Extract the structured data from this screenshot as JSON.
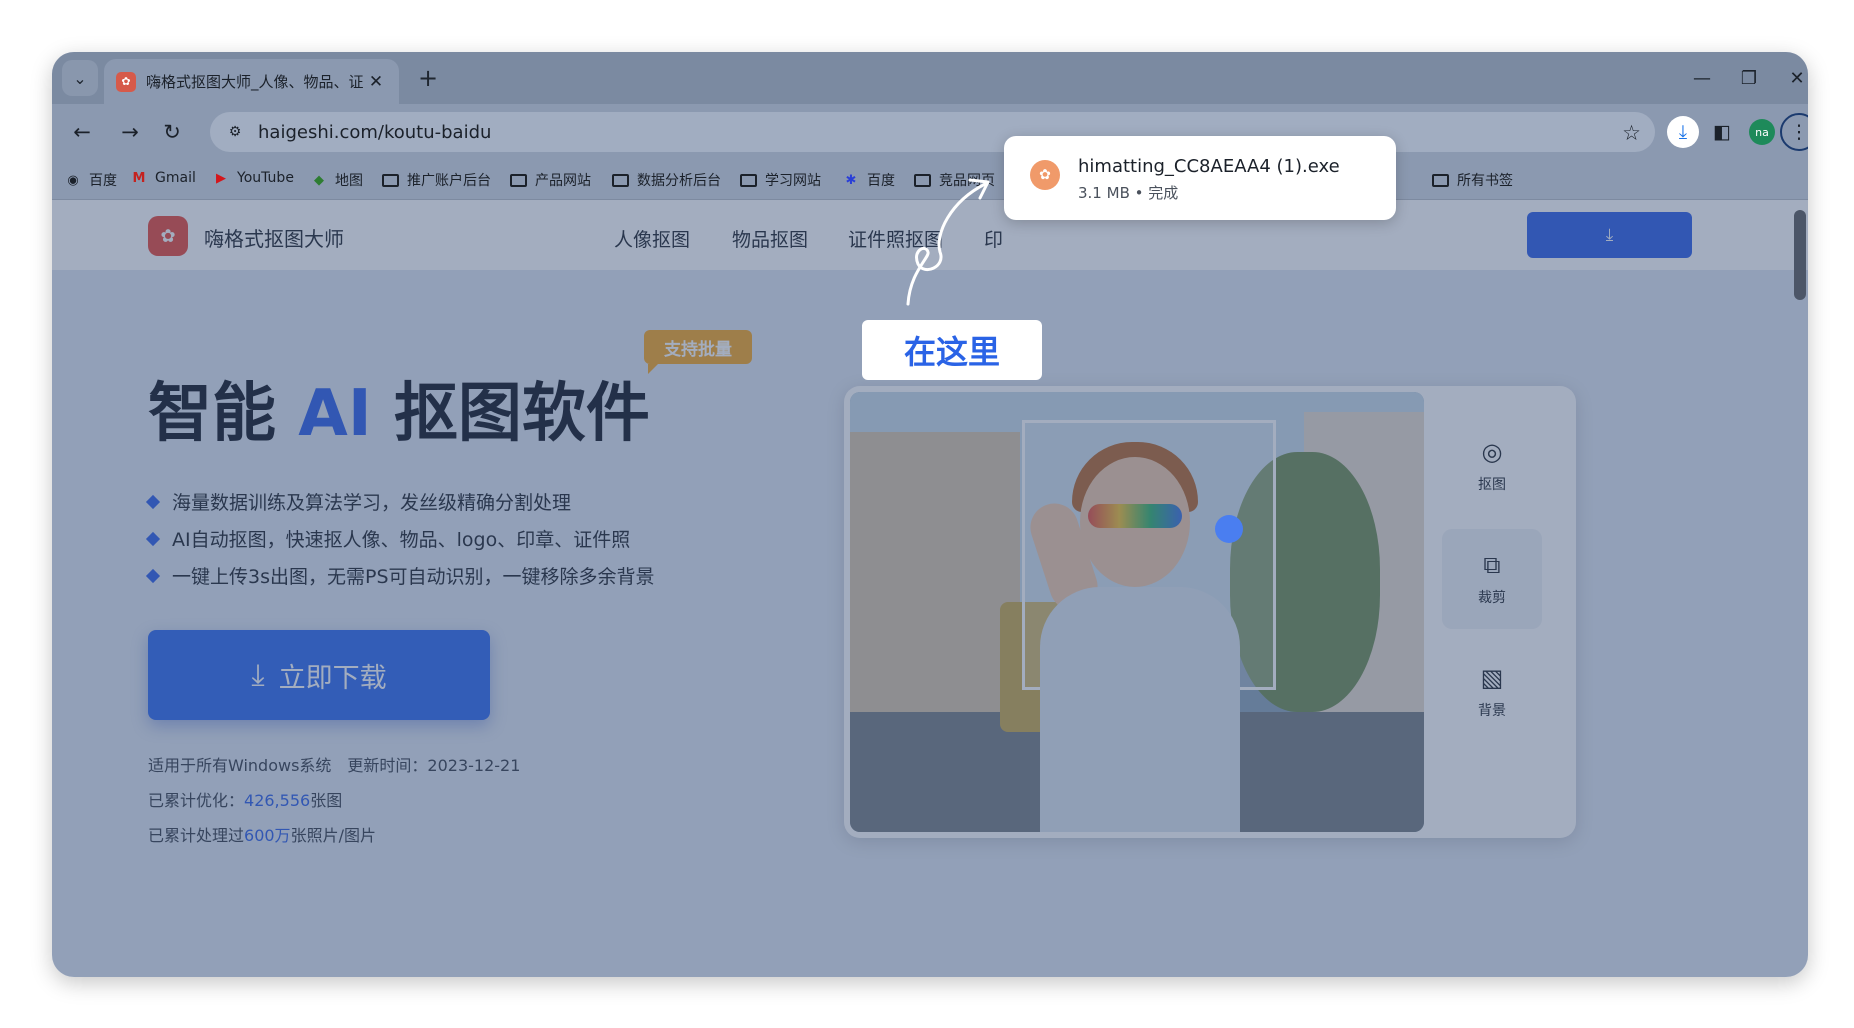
{
  "tab": {
    "title": "嗨格式抠图大师_人像、物品、证"
  },
  "address": {
    "url": "haigeshi.com/koutu-baidu"
  },
  "bookmarks": [
    {
      "label": "百度"
    },
    {
      "label": "Gmail"
    },
    {
      "label": "YouTube"
    },
    {
      "label": "地图"
    },
    {
      "label": "推广账户后台"
    },
    {
      "label": "产品网站"
    },
    {
      "label": "数据分析后台"
    },
    {
      "label": "学习网站"
    },
    {
      "label": "百度"
    },
    {
      "label": "竞品网页"
    },
    {
      "label": "所有书签"
    }
  ],
  "download_popup": {
    "filename": "himatting_CC8AEAA4 (1).exe",
    "meta": "3.1 MB • 完成"
  },
  "hint": {
    "text": "在这里"
  },
  "site": {
    "brand": "嗨格式抠图大师",
    "nav": [
      "人像抠图",
      "物品抠图",
      "证件照抠图",
      "印"
    ],
    "badge": "支持批量",
    "title_a": "智能",
    "title_ai": "AI",
    "title_b": "抠图软件",
    "features": [
      "海量数据训练及算法学习，发丝级精确分割处理",
      "AI自动抠图，快速抠人像、物品、logo、印章、证件照",
      "一键上传3s出图，无需PS可自动识别，一键移除多余背景"
    ],
    "download_label": "立即下载",
    "meta1": "适用于所有Windows系统　更新时间：2023-12-21",
    "meta2_prefix": "已累计优化：",
    "meta2_num": "426,556",
    "meta2_suffix": "张图",
    "meta3_prefix": "已累计处理过",
    "meta3_num": "600万",
    "meta3_suffix": "张照片/图片",
    "tools": [
      "抠图",
      "裁剪",
      "背景"
    ]
  },
  "colors": {
    "accent": "#2a5ee8",
    "badge": "#f5a623",
    "hint_text": "#2a63e6"
  }
}
